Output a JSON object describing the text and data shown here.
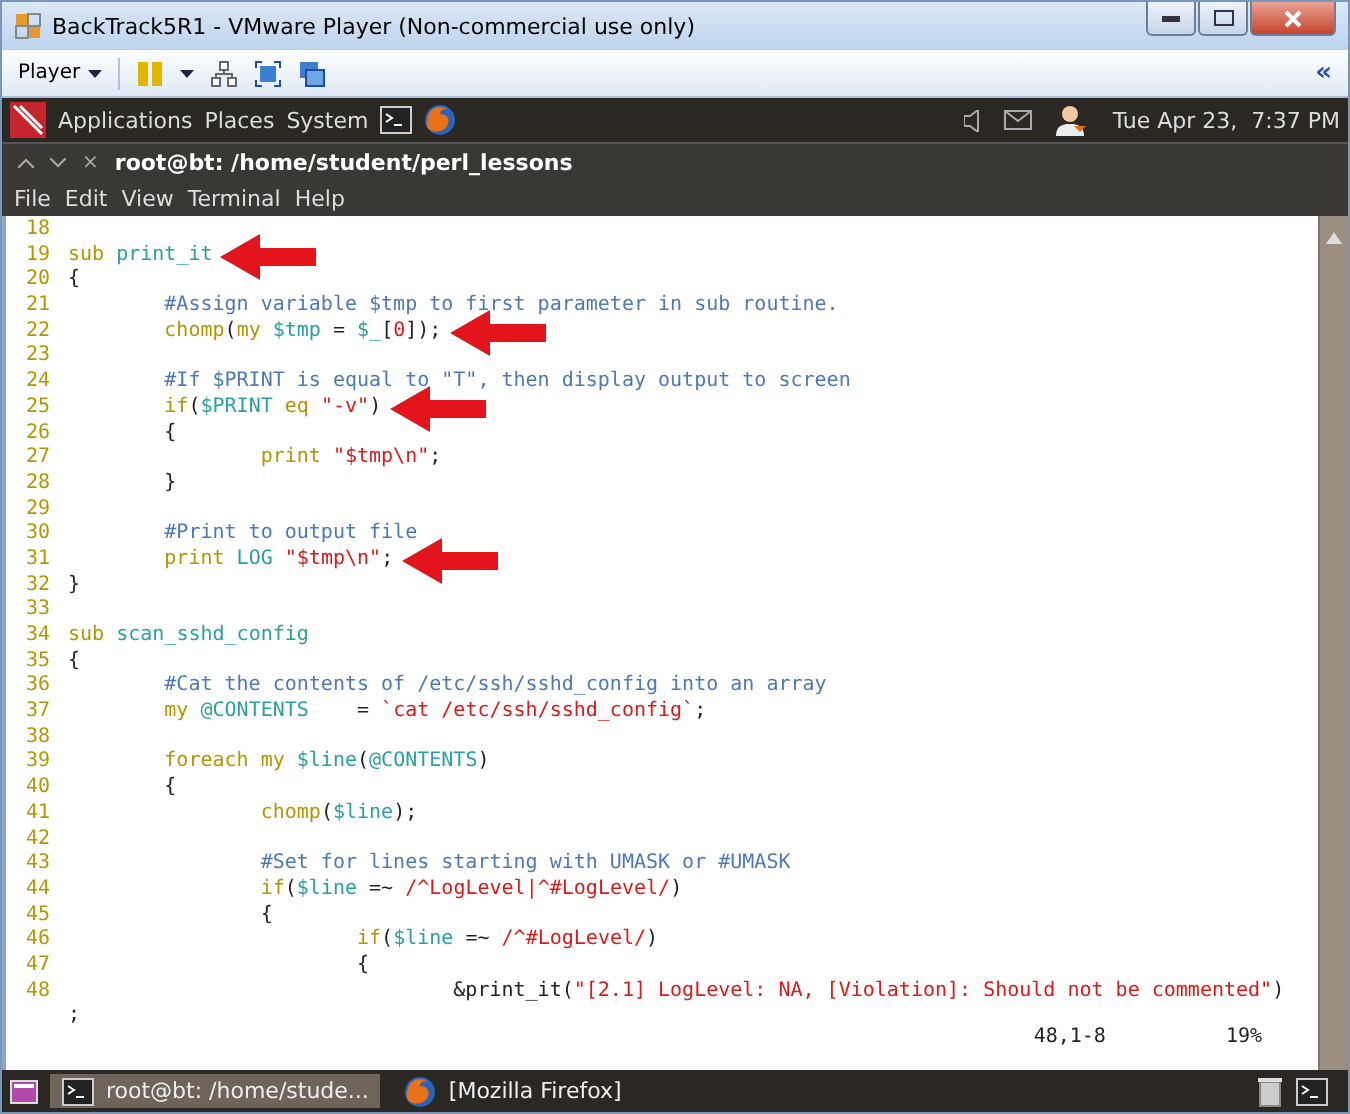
{
  "window": {
    "title": "BackTrack5R1 - VMware Player (Non-commercial use only)"
  },
  "toolbar": {
    "player_menu": "Player",
    "collapse": "«"
  },
  "panel": {
    "menus": [
      "Applications",
      "Places",
      "System"
    ],
    "clock": "Tue Apr 23,  7:37 PM"
  },
  "terminal": {
    "title": "root@bt: /home/student/perl_lessons",
    "close": "×",
    "menu": [
      "File",
      "Edit",
      "View",
      "Terminal",
      "Help"
    ],
    "lines": [
      {
        "n": "18"
      },
      {
        "n": "19",
        "arrow": true,
        "segments": [
          {
            "kind": "keyword",
            "text": "sub "
          },
          {
            "kind": "name",
            "text": "print_it"
          }
        ]
      },
      {
        "n": "20",
        "segments": [
          {
            "kind": "plain",
            "text": "{"
          }
        ]
      },
      {
        "n": "21",
        "segments": [
          {
            "kind": "comment",
            "text": "        #Assign variable $tmp to first parameter in sub routine."
          }
        ]
      },
      {
        "n": "22",
        "arrow": true,
        "segments": [
          {
            "kind": "keyword",
            "text": "        chomp"
          },
          {
            "kind": "plain",
            "text": "("
          },
          {
            "kind": "keyword",
            "text": "my "
          },
          {
            "kind": "name",
            "text": "$tmp"
          },
          {
            "kind": "plain",
            "text": " = "
          },
          {
            "kind": "name",
            "text": "$_"
          },
          {
            "kind": "plain",
            "text": "["
          },
          {
            "kind": "string",
            "text": "0"
          },
          {
            "kind": "plain",
            "text": "]);"
          }
        ]
      },
      {
        "n": "23"
      },
      {
        "n": "24",
        "segments": [
          {
            "kind": "comment",
            "text": "        #If $PRINT is equal to \"T\", then display output to screen"
          }
        ]
      },
      {
        "n": "25",
        "arrow": true,
        "segments": [
          {
            "kind": "keyword",
            "text": "        if"
          },
          {
            "kind": "plain",
            "text": "("
          },
          {
            "kind": "name",
            "text": "$PRINT"
          },
          {
            "kind": "keyword",
            "text": " eq "
          },
          {
            "kind": "string",
            "text": "\"-v\""
          },
          {
            "kind": "plain",
            "text": ")"
          }
        ]
      },
      {
        "n": "26",
        "segments": [
          {
            "kind": "plain",
            "text": "        {"
          }
        ]
      },
      {
        "n": "27",
        "segments": [
          {
            "kind": "keyword",
            "text": "                print "
          },
          {
            "kind": "string",
            "text": "\"$tmp\\n\""
          },
          {
            "kind": "plain",
            "text": ";"
          }
        ]
      },
      {
        "n": "28",
        "segments": [
          {
            "kind": "plain",
            "text": "        }"
          }
        ]
      },
      {
        "n": "29"
      },
      {
        "n": "30",
        "segments": [
          {
            "kind": "comment",
            "text": "        #Print to output file"
          }
        ]
      },
      {
        "n": "31",
        "arrow": true,
        "segments": [
          {
            "kind": "keyword",
            "text": "        print "
          },
          {
            "kind": "name",
            "text": "LOG "
          },
          {
            "kind": "string",
            "text": "\"$tmp\\n\""
          },
          {
            "kind": "plain",
            "text": ";"
          }
        ]
      },
      {
        "n": "32",
        "segments": [
          {
            "kind": "plain",
            "text": "}"
          }
        ]
      },
      {
        "n": "33"
      },
      {
        "n": "34",
        "segments": [
          {
            "kind": "keyword",
            "text": "sub "
          },
          {
            "kind": "name",
            "text": "scan_sshd_config"
          }
        ]
      },
      {
        "n": "35",
        "segments": [
          {
            "kind": "plain",
            "text": "{"
          }
        ]
      },
      {
        "n": "36",
        "segments": [
          {
            "kind": "comment",
            "text": "        #Cat the contents of /etc/ssh/sshd_config into an array"
          }
        ]
      },
      {
        "n": "37",
        "segments": [
          {
            "kind": "keyword",
            "text": "        my "
          },
          {
            "kind": "name",
            "text": "@CONTENTS"
          },
          {
            "kind": "plain",
            "text": "    = "
          },
          {
            "kind": "string",
            "text": "`cat /etc/ssh/sshd_config`"
          },
          {
            "kind": "plain",
            "text": ";"
          }
        ]
      },
      {
        "n": "38"
      },
      {
        "n": "39",
        "segments": [
          {
            "kind": "keyword",
            "text": "        foreach my "
          },
          {
            "kind": "name",
            "text": "$line"
          },
          {
            "kind": "plain",
            "text": "("
          },
          {
            "kind": "name",
            "text": "@CONTENTS"
          },
          {
            "kind": "plain",
            "text": ")"
          }
        ]
      },
      {
        "n": "40",
        "segments": [
          {
            "kind": "plain",
            "text": "        {"
          }
        ]
      },
      {
        "n": "41",
        "segments": [
          {
            "kind": "keyword",
            "text": "                chomp"
          },
          {
            "kind": "plain",
            "text": "("
          },
          {
            "kind": "name",
            "text": "$line"
          },
          {
            "kind": "plain",
            "text": ");"
          }
        ]
      },
      {
        "n": "42"
      },
      {
        "n": "43",
        "segments": [
          {
            "kind": "comment",
            "text": "                #Set for lines starting with UMASK or #UMASK"
          }
        ]
      },
      {
        "n": "44",
        "segments": [
          {
            "kind": "keyword",
            "text": "                if"
          },
          {
            "kind": "plain",
            "text": "("
          },
          {
            "kind": "name",
            "text": "$line"
          },
          {
            "kind": "plain",
            "text": " =~ "
          },
          {
            "kind": "string",
            "text": "/^LogLevel|^#LogLevel/"
          },
          {
            "kind": "plain",
            "text": ")"
          }
        ]
      },
      {
        "n": "45",
        "segments": [
          {
            "kind": "plain",
            "text": "                {"
          }
        ]
      },
      {
        "n": "46",
        "segments": [
          {
            "kind": "keyword",
            "text": "                        if"
          },
          {
            "kind": "plain",
            "text": "("
          },
          {
            "kind": "name",
            "text": "$line"
          },
          {
            "kind": "plain",
            "text": " =~ "
          },
          {
            "kind": "string",
            "text": "/^#LogLevel/"
          },
          {
            "kind": "plain",
            "text": ")"
          }
        ]
      },
      {
        "n": "47",
        "segments": [
          {
            "kind": "plain",
            "text": "                        {"
          }
        ]
      },
      {
        "n": "48",
        "segments": [
          {
            "kind": "plain",
            "text": "                                &print_it("
          },
          {
            "kind": "string",
            "text": "\"[2.1] LogLevel: NA, [Violation]: Should not be commented\""
          },
          {
            "kind": "plain",
            "text": ")"
          }
        ]
      },
      {
        "segments": [
          {
            "kind": "plain",
            "text": ";"
          }
        ]
      }
    ],
    "status": {
      "position": "48,1-8",
      "percent": "19%"
    }
  },
  "taskbar": {
    "tasks": [
      {
        "label": "root@bt: /home/stude...",
        "kind": "terminal",
        "selected": true
      },
      {
        "label": "[Mozilla Firefox]",
        "kind": "browser",
        "selected": false
      }
    ]
  }
}
